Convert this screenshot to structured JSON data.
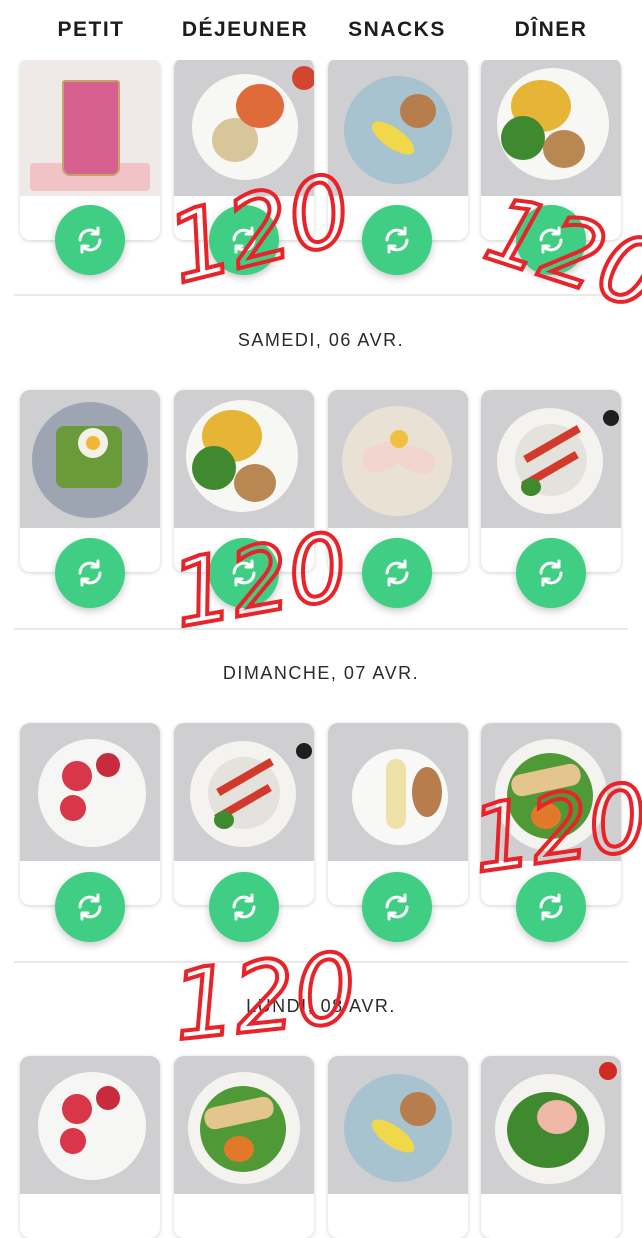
{
  "columns": [
    "PETIT",
    "DÉJEUNER",
    "SNACKS",
    "DÎNER"
  ],
  "days": [
    {
      "label": "SAMEDI, 06 AVR."
    },
    {
      "label": "DIMANCHE, 07 AVR."
    },
    {
      "label": "LUNDI, 08 AVR."
    }
  ],
  "annotations": [
    "120",
    "120",
    "120",
    "120",
    "120"
  ],
  "colors": {
    "accent": "#3fce83",
    "annotation": "#e8242a"
  }
}
